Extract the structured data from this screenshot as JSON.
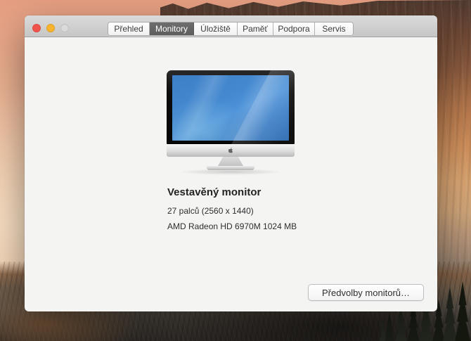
{
  "window": {
    "tabs": [
      {
        "label": "Přehled",
        "selected": false
      },
      {
        "label": "Monitory",
        "selected": true
      },
      {
        "label": "Úložiště",
        "selected": false
      },
      {
        "label": "Paměť",
        "selected": false
      },
      {
        "label": "Podpora",
        "selected": false
      },
      {
        "label": "Servis",
        "selected": false
      }
    ],
    "traffic_lights": [
      {
        "name": "close",
        "color": "#f0544c"
      },
      {
        "name": "minimize",
        "color": "#f6b42e"
      },
      {
        "name": "zoom-disabled",
        "color": "#dadada"
      }
    ],
    "display_info": {
      "heading": "Vestavěný monitor",
      "size": "27 palců (2560 x 1440)",
      "graphics": "AMD Radeon HD 6970M 1024 MB"
    },
    "preferences_button": "Předvolby monitorů…"
  },
  "icons": {
    "apple_logo": "apple-logo"
  },
  "colors": {
    "titlebar_top": "#dadada",
    "titlebar_bottom": "#c6c6c6",
    "tab_selected_bg": "#646464",
    "window_bg": "#f4f4f3",
    "imac_screen_blue": "#4489d0",
    "wallpaper_sky_peach": "#efc1a0",
    "wallpaper_cliff_orange": "#cf8f5b",
    "wallpaper_ground_dark": "#3e3933"
  }
}
